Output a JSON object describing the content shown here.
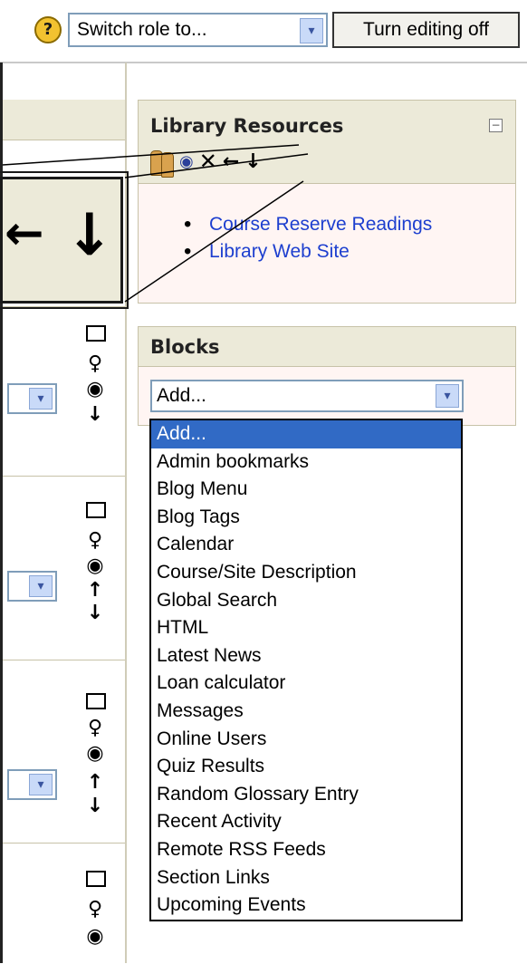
{
  "toolbar": {
    "help_icon_glyph": "?",
    "role_select_value": "Switch role to...",
    "edit_button_label": "Turn editing off"
  },
  "zoom_callout": {
    "left_arrow": "←",
    "down_arrow": "↓"
  },
  "library_block": {
    "title": "Library Resources",
    "collapse_glyph": "−",
    "icons": [
      "roles-icon",
      "show-hide-eye-icon",
      "delete-x-icon",
      "move-left-arrow-icon",
      "move-down-arrow-icon"
    ],
    "links": [
      "Course Reserve Readings",
      "Library Web Site"
    ]
  },
  "blocks_block": {
    "title": "Blocks",
    "add_select_value": "Add...",
    "options": [
      "Add...",
      "Admin bookmarks",
      "Blog Menu",
      "Blog Tags",
      "Calendar",
      "Course/Site Description",
      "Global Search",
      "HTML",
      "Latest News",
      "Loan calculator",
      "Messages",
      "Online Users",
      "Quiz Results",
      "Random Glossary Entry",
      "Recent Activity",
      "Remote RSS Feeds",
      "Section Links",
      "Upcoming Events"
    ],
    "selected_option": "Add..."
  },
  "section_controls": {
    "box": "□",
    "bulb": "♀",
    "eye": "◉",
    "up": "↑",
    "down": "↓"
  },
  "colors": {
    "accent_highlight": "#316ac5",
    "link": "#1d3fcf",
    "block_header": "#ecead9",
    "block_body": "#fff5f3"
  }
}
